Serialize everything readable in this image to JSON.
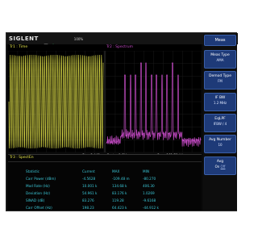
{
  "device": {
    "logo": "SIGLENT",
    "battery": "100%"
  },
  "traces": {
    "tr1_label": "Tr1 : Time",
    "tr2_label": "Tr2 : Spectrum"
  },
  "axis": {
    "left_info": "Stop 2.448 ms  Center 1 GHz",
    "right_info": "Span 162.76 kHz"
  },
  "stats": {
    "panel_title": "Tr3 : SpectEn",
    "headers": [
      "Statistic",
      "Current",
      "MAX",
      "MIN"
    ],
    "rows": [
      [
        "Carr Power (dBm)",
        "-4.5628",
        "-109.48 m",
        "-80.270"
      ],
      [
        "Mod Rate (Hz)",
        "10.001 k",
        "134.68 k",
        "406.30"
      ],
      [
        "Deviation (Hz)",
        "54.961 k",
        "83.176 k",
        "1.0269"
      ],
      [
        "SINAD (dB)",
        "83.276",
        "119.28",
        "-9.6168"
      ],
      [
        "Carr Offset (Hz)",
        "198.23",
        "64.423 k",
        "-44.912 k"
      ]
    ]
  },
  "softkeys": {
    "meas": "Meas",
    "meas_type_title": "Meas Type",
    "meas_type_value": "AMA",
    "demod_type_title": "Demod Type",
    "demod_type_value": "FM",
    "if_bw_title": "IF BW",
    "if_bw_value": "1.2 MHz",
    "eq_lpf_title": "EqLPF",
    "eq_lpf_value": "IFBW / 4",
    "avg_number_title": "Avg Number",
    "avg_number_value": "10",
    "avg_title": "Avg",
    "avg_on": "On",
    "avg_off": "Off"
  },
  "colors": {
    "time_trace": "#e4e44a",
    "spectrum_trace": "#c44ac4",
    "stats_text": "#3cc8d8",
    "softkey_bg": "#1e3a78"
  }
}
